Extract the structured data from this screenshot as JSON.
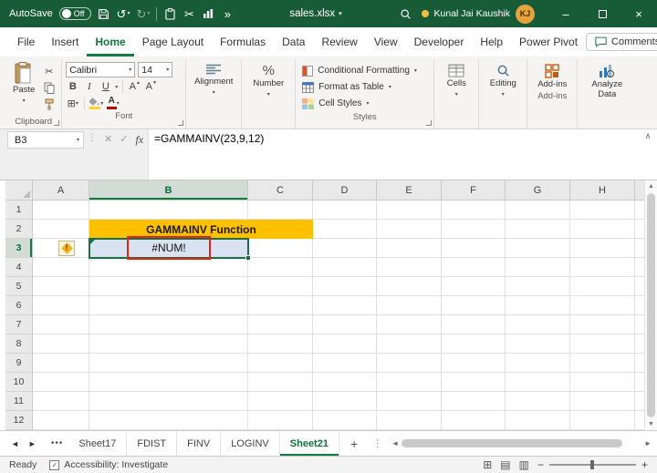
{
  "titlebar": {
    "autosave_label": "AutoSave",
    "autosave_state": "Off",
    "filename": "sales.xlsx",
    "user_name": "Kunal Jai Kaushik",
    "user_initials": "KJ"
  },
  "menubar": {
    "items": [
      "File",
      "Insert",
      "Home",
      "Page Layout",
      "Formulas",
      "Data",
      "Review",
      "View",
      "Developer",
      "Help",
      "Power Pivot"
    ],
    "active_item": "Home",
    "comments_label": "Comments"
  },
  "ribbon": {
    "paste_label": "Paste",
    "clipboard_group_label": "Clipboard",
    "font_name": "Calibri",
    "font_size": "14",
    "bold_label": "B",
    "italic_label": "I",
    "underline_label": "U",
    "font_group_label": "Font",
    "alignment_label": "Alignment",
    "number_label": "Number",
    "conditional_formatting_label": "Conditional Formatting",
    "format_as_table_label": "Format as Table",
    "cell_styles_label": "Cell Styles",
    "styles_group_label": "Styles",
    "cells_label": "Cells",
    "editing_label": "Editing",
    "addins_label": "Add-ins",
    "addins_group_label": "Add-ins",
    "analyze_data_label": "Analyze Data"
  },
  "formula_bar": {
    "cell_reference": "B3",
    "fx_label": "fx",
    "cancel_glyph": "✕",
    "enter_glyph": "✓",
    "formula": "=GAMMAINV(23,9,12)"
  },
  "grid": {
    "column_headers": [
      "A",
      "B",
      "C",
      "D",
      "E",
      "F",
      "G",
      "H"
    ],
    "row_headers": [
      "1",
      "2",
      "3",
      "4",
      "5",
      "6",
      "7",
      "8",
      "9",
      "10",
      "11",
      "12"
    ],
    "selected_column": "B",
    "selected_row": "3",
    "selected_cell": "B3",
    "title_cell": {
      "cell_range": "B2:C2",
      "text": "GAMMAINV Function",
      "fill_color": "#FFC000"
    },
    "error_cell": {
      "cell": "B3",
      "text": "#NUM!",
      "fill_color": "#D9E2F1"
    }
  },
  "sheet_tabs": {
    "nav_ellipsis": "•••",
    "tabs": [
      "Sheet17",
      "FDIST",
      "FINV",
      "LOGINV",
      "Sheet21"
    ],
    "active_tab": "Sheet21",
    "add_sheet_label": "+"
  },
  "status_bar": {
    "ready_label": "Ready",
    "accessibility_label": "Accessibility: Investigate"
  },
  "colors": {
    "titlebar_green": "#185C37",
    "accent_green": "#107C41",
    "header_fill": "#FFC000",
    "error_fill": "#D9E2F1",
    "annotation_red": "#F02011",
    "avatar_gold": "#E8A33D"
  }
}
